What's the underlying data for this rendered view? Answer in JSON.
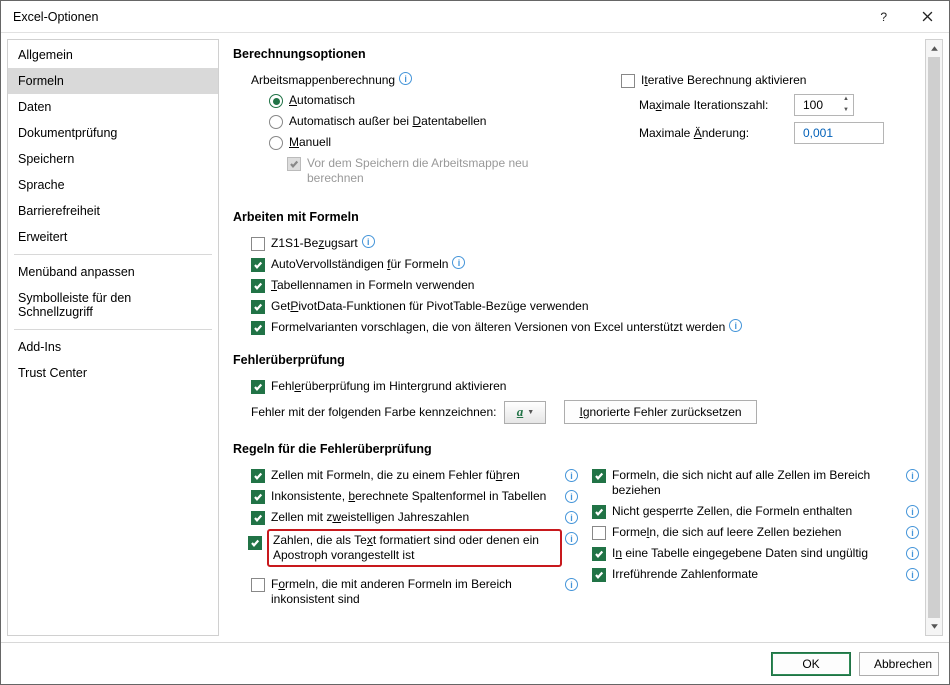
{
  "titlebar": {
    "title": "Excel-Optionen"
  },
  "sidebar": {
    "groups": [
      [
        "Allgemein",
        "Formeln",
        "Daten",
        "Dokumentprüfung",
        "Speichern",
        "Sprache",
        "Barrierefreiheit",
        "Erweitert"
      ],
      [
        "Menüband anpassen",
        "Symbolleiste für den Schnellzugriff"
      ],
      [
        "Add-Ins",
        "Trust Center"
      ]
    ],
    "selected": "Formeln"
  },
  "content": {
    "calc": {
      "heading": "Berechnungsoptionen",
      "groupLabel": "Arbeitsmappenberechnung",
      "radios": {
        "auto": "Automatisch",
        "auto_except": "Automatisch außer bei Datentabellen",
        "manual": "Manuell"
      },
      "recalc_before_save": "Vor dem Speichern die Arbeitsmappe neu berechnen",
      "iteration_cb": "Iterative Berechnung aktivieren",
      "max_iter_label": "Maximale Iterationszahl:",
      "max_iter_value": "100",
      "max_change_label": "Maximale Änderung:",
      "max_change_value": "0,001"
    },
    "work": {
      "heading": "Arbeiten mit Formeln",
      "r1c1": "Z1S1-Bezugsart",
      "autocomplete": "AutoVervollständigen für Formeln",
      "tablenames": "Tabellennamen in Formeln verwenden",
      "getpivot": "GetPivotData-Funktionen für PivotTable-Bezüge verwenden",
      "legacy": "Formelvarianten vorschlagen, die von älteren Versionen von Excel unterstützt werden"
    },
    "err": {
      "heading": "Fehlerüberprüfung",
      "bg": "Fehlerüberprüfung im Hintergrund aktivieren",
      "colorLabel": "Fehler mit der folgenden Farbe kennzeichnen:",
      "reset": "Ignorierte Fehler zurücksetzen"
    },
    "rules": {
      "heading": "Regeln für die Fehlerüberprüfung",
      "left": [
        "Zellen mit Formeln, die zu einem Fehler führen",
        "Inkonsistente, berechnete Spaltenformel in Tabellen",
        "Zellen mit zweistelligen Jahreszahlen",
        "Zahlen, die als Text formatiert sind oder denen ein Apostroph vorangestellt ist",
        "Formeln, die mit anderen Formeln im Bereich inkonsistent sind"
      ],
      "right": [
        "Formeln, die sich nicht auf alle Zellen im Bereich beziehen",
        "Nicht gesperrte Zellen, die Formeln enthalten",
        "Formeln, die sich auf leere Zellen beziehen",
        "In eine Tabelle eingegebene Daten sind ungültig",
        "Irreführende Zahlenformate"
      ]
    }
  },
  "footer": {
    "ok": "OK",
    "cancel": "Abbrechen"
  }
}
